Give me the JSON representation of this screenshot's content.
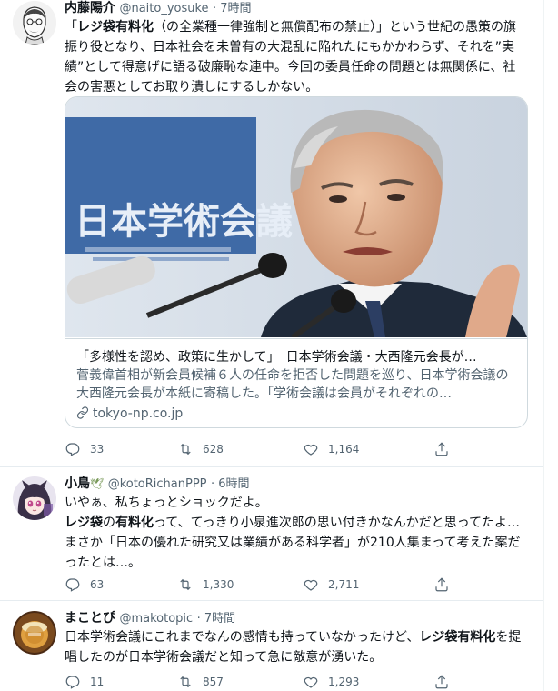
{
  "tweets": [
    {
      "name": "内藤陽介",
      "handle": "@naito_yosuke",
      "time": "· 7時間",
      "body_parts": [
        {
          "t": "「",
          "bold": false
        },
        {
          "t": "レジ袋有料化",
          "bold": true
        },
        {
          "t": "（の全業種一律強制と無償配布の禁止）」という世紀の愚策の旗振り役となり、日本社会を未曽有の大混乱に陥れたにもかかわらず、それを”実績”として得意げに語る破廉恥な連中。今回の委員任命の問題とは無関係に、社会の害悪としてお取り潰しにするしかない。",
          "bold": false
        }
      ],
      "card": {
        "title": "「多様性を認め、政策に生かして」　日本学術会議・大西隆元会長が…",
        "description": "菅義偉首相が新会員候補６人の任命を拒否した問題を巡り、日本学術会議の大西隆元会長が本紙に寄稿した。「学術会議は会員がそれぞれの…",
        "domain": "tokyo-np.co.jp",
        "sign_text": "日本学術会議"
      },
      "stats": {
        "replies": "33",
        "retweets": "628",
        "likes": "1,164"
      }
    },
    {
      "name": "小鳥",
      "name_emoji": "🕊",
      "handle": "@kotoRichanPPP",
      "time": "· 6時間",
      "line1": "いやぁ、私ちょっとショックだよ。",
      "body_parts": [
        {
          "t": "レジ袋",
          "bold": true
        },
        {
          "t": "の",
          "bold": false
        },
        {
          "t": "有料化",
          "bold": true
        },
        {
          "t": "って、てっきり小泉進次郎の思い付きかなんかだと思ってたよ…まさか「日本の優れた研究又は業績がある科学者」が210人集まって考えた案だったとは…。",
          "bold": false
        }
      ],
      "stats": {
        "replies": "63",
        "retweets": "1,330",
        "likes": "2,711"
      }
    },
    {
      "name": "まことぴ",
      "handle": "@makotopic",
      "time": "· 7時間",
      "body_parts": [
        {
          "t": "日本学術会議にこれまでなんの感情も持っていなかったけど、",
          "bold": false
        },
        {
          "t": "レジ袋有料化",
          "bold": true
        },
        {
          "t": "を提唱したのが日本学術会議だと知って急に敵意が湧いた。",
          "bold": false
        }
      ],
      "stats": {
        "replies": "11",
        "retweets": "857",
        "likes": "1,293"
      }
    }
  ],
  "icons": {
    "reply": "reply-icon",
    "retweet": "retweet-icon",
    "like": "heart-icon",
    "share": "share-icon",
    "link": "link-icon"
  },
  "colors": {
    "text": "#0f1419",
    "muted": "#536471",
    "border": "#cfd9de",
    "sign_blue": "#3f6aa6"
  }
}
